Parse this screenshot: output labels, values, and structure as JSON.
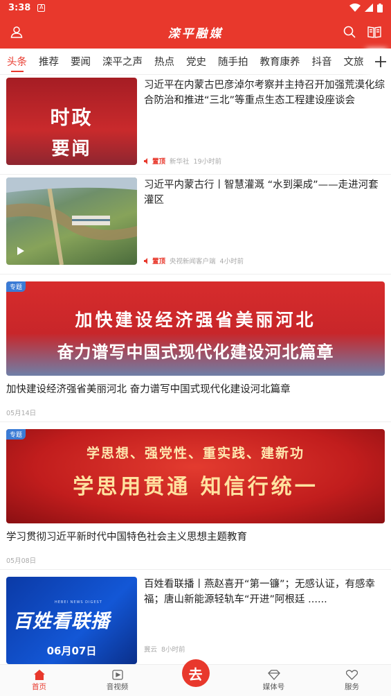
{
  "status_bar": {
    "time": "3:38",
    "notification_glyph": "A"
  },
  "header": {
    "title": "滦平融媒"
  },
  "tabs": [
    {
      "label": "头条",
      "active": true
    },
    {
      "label": "推荐"
    },
    {
      "label": "要闻"
    },
    {
      "label": "滦平之声"
    },
    {
      "label": "热点"
    },
    {
      "label": "党史"
    },
    {
      "label": "随手拍"
    },
    {
      "label": "教育康养"
    },
    {
      "label": "抖音"
    },
    {
      "label": "文旅"
    }
  ],
  "feed": {
    "items": [
      {
        "headline": "习近平在内蒙古巴彦淖尔考察并主持召开加强荒漠化综合防治和推进“三北”等重点生态工程建设座谈会",
        "thumb_line1": "时政",
        "thumb_line2": "要闻",
        "pin": "置顶",
        "source": "新华社",
        "time": "19小时前"
      },
      {
        "headline": "习近平内蒙古行丨智慧灌溉 “水到渠成”——走进河套灌区",
        "pin": "置顶",
        "source": "央视新闻客户端",
        "time": "4小时前"
      },
      {
        "badge": "专题",
        "banner_line1": "加快建设经济强省美丽河北",
        "banner_line2": "奋力谱写中国式现代化建设河北篇章",
        "title": "加快建设经济强省美丽河北 奋力谱写中国式现代化建设河北篇章",
        "date": "05月14日"
      },
      {
        "badge": "专题",
        "banner_line1": "学思想、强党性、重实践、建新功",
        "banner_line2": "学思用贯通 知信行统一",
        "title": "学习贯彻习近平新时代中国特色社会主义思想主题教育",
        "date": "05月08日"
      },
      {
        "headline": "百姓看联播丨燕赵喜开“第一镰”；无感认证，有感幸福；唐山新能源轻轨车“开进”阿根廷 ......",
        "thumb_title": "百姓看联播",
        "thumb_sub": "HEBEI NEWS DIGEST",
        "thumb_date": "06月07日",
        "source": "冀云",
        "time": "8小时前"
      }
    ]
  },
  "bottom_nav": {
    "home": "首页",
    "video": "音视频",
    "center_glyph": "去",
    "media": "媒体号",
    "service": "服务"
  },
  "colors": {
    "brand_red": "#e8382c",
    "badge_blue": "#3a7bd5"
  }
}
